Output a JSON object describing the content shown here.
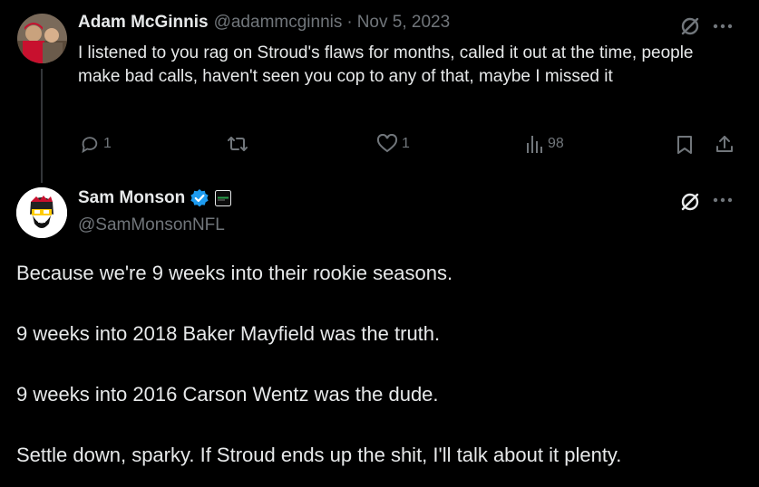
{
  "reply": {
    "author_name": "Adam McGinnis",
    "author_handle": "@adammcginnis",
    "separator": "·",
    "date": "Nov 5, 2023",
    "text": "I listened to you rag on Stroud's flaws for months, called it out at the time, people make bad calls, haven't seen you cop to any of that, maybe I missed it",
    "actions": {
      "replies": "1",
      "likes": "1",
      "views": "98"
    },
    "icons": [
      "grok-icon",
      "more-icon",
      "reply-icon",
      "retweet-icon",
      "like-icon",
      "views-icon",
      "bookmark-icon",
      "share-icon"
    ]
  },
  "main": {
    "author_name": "Sam Monson",
    "author_handle": "@SamMonsonNFL",
    "paragraphs": [
      "Because we're 9 weeks into their rookie seasons.",
      "9 weeks into 2018 Baker Mayfield was the truth.",
      "9 weeks into 2016 Carson Wentz was the dude.",
      "Settle down, sparky. If Stroud ends up the shit, I'll talk about it plenty."
    ],
    "icons": [
      "verified-badge-icon",
      "affiliate-badge-icon",
      "grok-icon",
      "more-icon"
    ]
  },
  "colors": {
    "background": "#000000",
    "text": "#e7e9ea",
    "secondary": "#71767b",
    "verified": "#1d9bf0",
    "thread_line": "#333639"
  }
}
